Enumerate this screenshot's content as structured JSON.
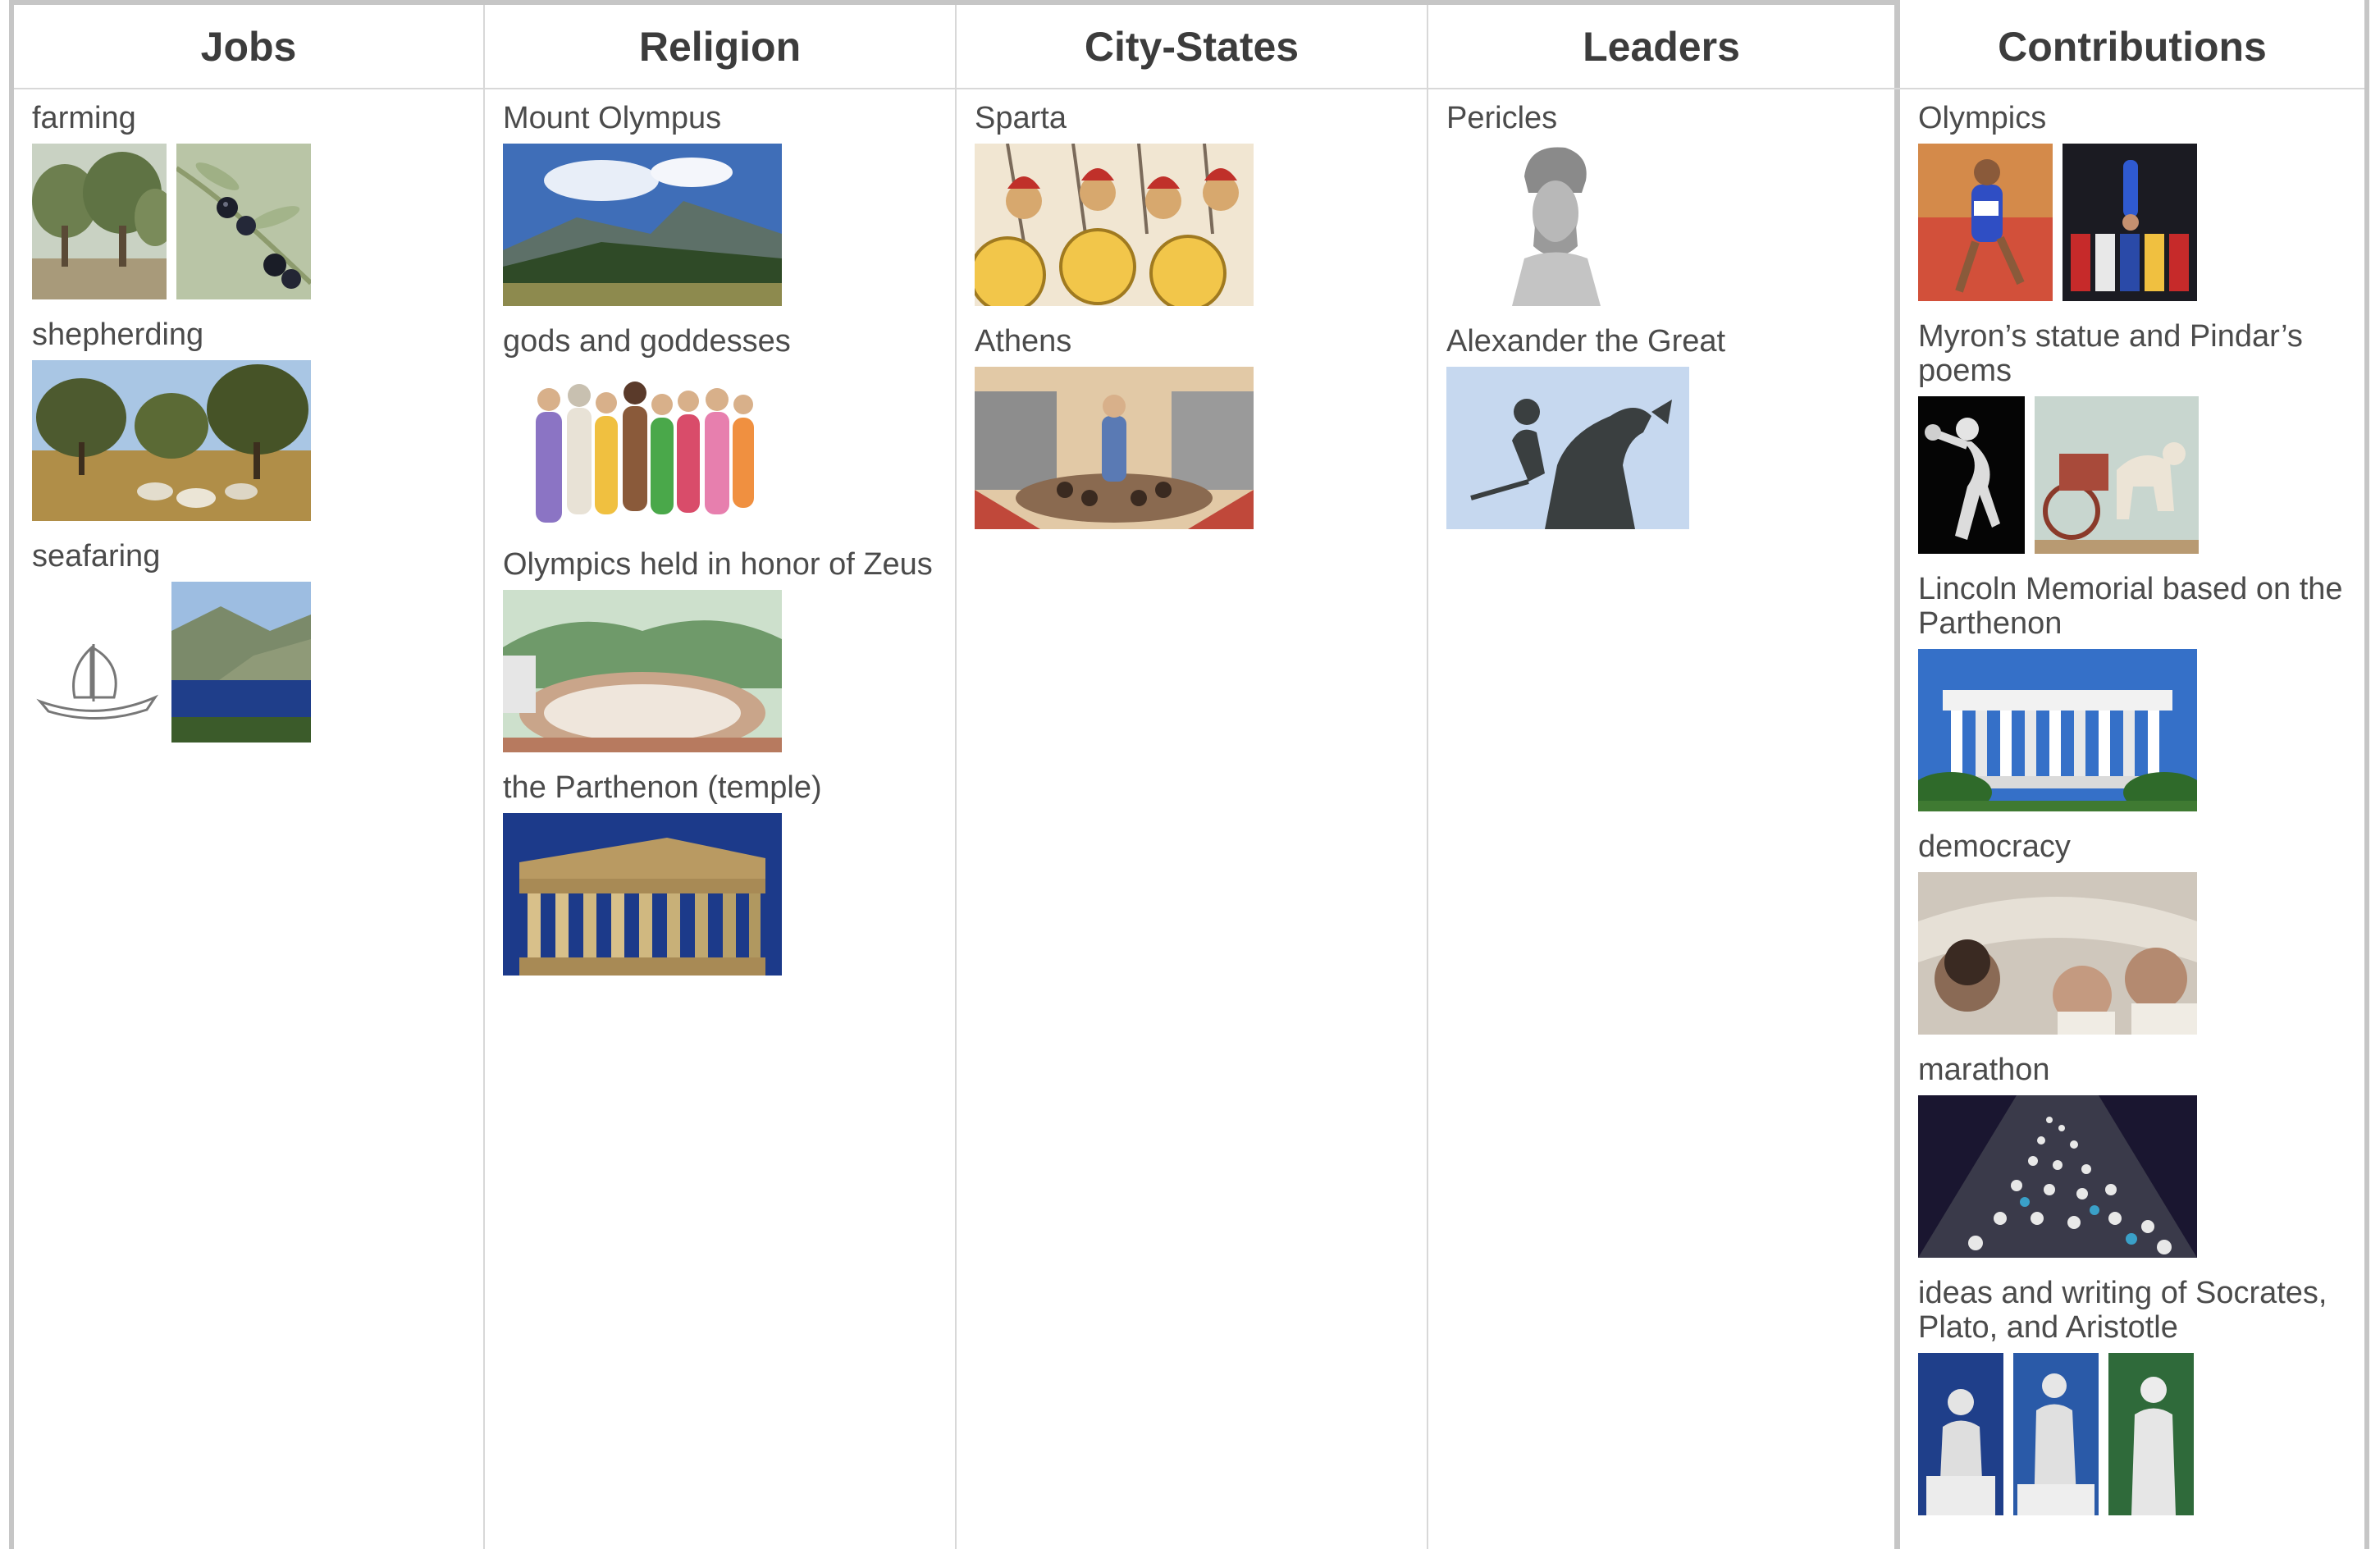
{
  "columns": [
    {
      "header": "Jobs",
      "items": [
        {
          "label": "farming",
          "images": [
            "olive-grove-photo",
            "olives-branch-photo"
          ]
        },
        {
          "label": "shepherding",
          "images": [
            "sheep-in-olive-grove-photo"
          ]
        },
        {
          "label": "seafaring",
          "images": [
            "ancient-ship-drawing",
            "coastline-photo"
          ]
        }
      ]
    },
    {
      "header": "Religion",
      "items": [
        {
          "label": "Mount Olympus",
          "images": [
            "mount-olympus-photo"
          ]
        },
        {
          "label": "gods and goddesses",
          "images": [
            "gods-goddesses-illustration"
          ]
        },
        {
          "label": "Olympics held in honor of Zeus",
          "images": [
            "ancient-stadium-painting"
          ]
        },
        {
          "label": "the Parthenon (temple)",
          "images": [
            "parthenon-photo"
          ]
        }
      ]
    },
    {
      "header": "City-States",
      "items": [
        {
          "label": "Sparta",
          "images": [
            "spartan-soldiers-illustration"
          ]
        },
        {
          "label": "Athens",
          "images": [
            "athens-assembly-illustration"
          ]
        }
      ]
    },
    {
      "header": "Leaders",
      "items": [
        {
          "label": "Pericles",
          "images": [
            "pericles-bust-photo"
          ]
        },
        {
          "label": "Alexander the Great",
          "images": [
            "alexander-statue-photo"
          ]
        }
      ]
    },
    {
      "header": "Contributions",
      "items": [
        {
          "label": "Olympics",
          "images": [
            "runner-photo",
            "gymnast-flags-photo"
          ]
        },
        {
          "label": "Myron’s statue and Pindar’s poems",
          "images": [
            "discus-thrower-statue-photo",
            "chariot-fresco-photo"
          ]
        },
        {
          "label": "Lincoln Memorial based on the Parthenon",
          "images": [
            "lincoln-memorial-photo"
          ]
        },
        {
          "label": "democracy",
          "images": [
            "democracy-assembly-illustration"
          ]
        },
        {
          "label": "marathon",
          "images": [
            "marathon-crowd-photo"
          ]
        },
        {
          "label": "ideas and writing of Socrates, Plato, and Aristotle",
          "images": [
            "socrates-statue-photo",
            "plato-statue-photo",
            "aristotle-statue-photo"
          ]
        }
      ]
    }
  ]
}
